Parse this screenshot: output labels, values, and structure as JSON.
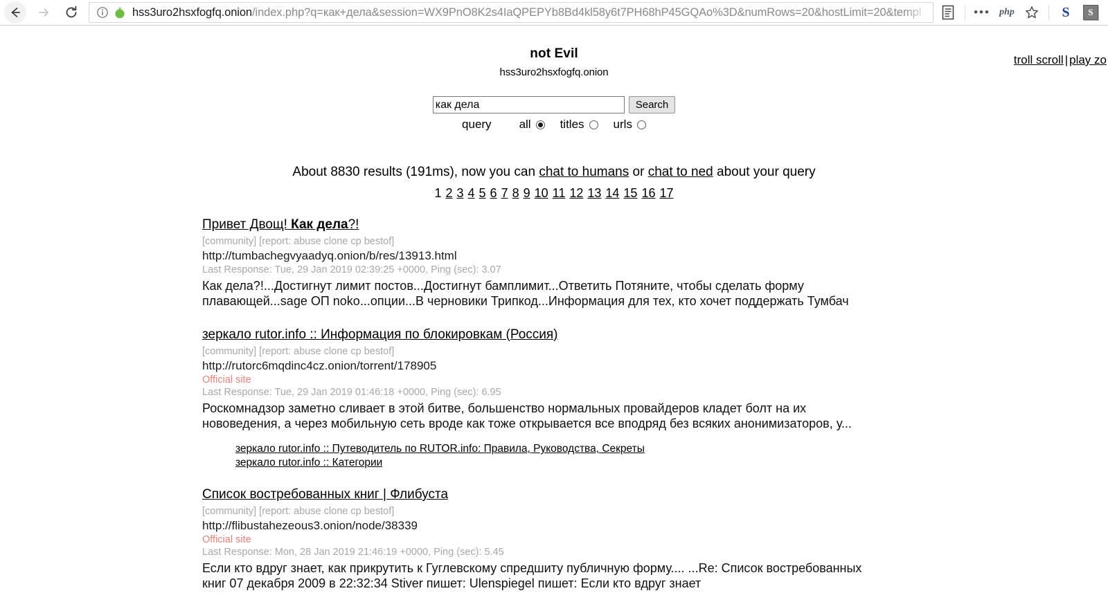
{
  "browser": {
    "back_label": "back-arrow",
    "forward_label": "forward-arrow",
    "reload_label": "reload",
    "url_host": "hss3uro2hsxfogfq.onion",
    "url_rest": "/index.php?q=как+дела&session=WX9PnO8K2s4IaQPEPYb8Bd4kl58y6t7PH68hP45GQAo%3D&numRows=20&hostLimit=20&templ",
    "toolbar_icons": [
      {
        "name": "reader-mode-icon",
        "glyph": "reader"
      },
      {
        "name": "more-options-icon",
        "glyph": "•••"
      },
      {
        "name": "php-extension-icon",
        "glyph": "php"
      },
      {
        "name": "bookmark-star-icon",
        "glyph": "star"
      },
      {
        "name": "s-extension-blue-icon",
        "glyph": "S"
      },
      {
        "name": "s-extension-gray-icon",
        "glyph": "S"
      }
    ]
  },
  "topright": {
    "troll_scroll": "troll scroll",
    "separator": "|",
    "play_zone": "play zo"
  },
  "site": {
    "title": "not Evil",
    "subtitle": "hss3uro2hsxfogfq.onion"
  },
  "search": {
    "query_value": "как дела",
    "placeholder": "",
    "button_label": "Search",
    "query_label": "query",
    "options": [
      {
        "label": "all",
        "checked": true
      },
      {
        "label": "titles",
        "checked": false
      },
      {
        "label": "urls",
        "checked": false
      }
    ]
  },
  "summary": {
    "prefix": "About 8830 results (191ms), now you can ",
    "chat_humans": "chat to humans",
    "middle": " or ",
    "chat_ned": "chat to ned",
    "suffix": " about your query",
    "result_count": "8830",
    "time_ms": "191ms"
  },
  "pagination": {
    "current": "1",
    "pages": [
      "2",
      "3",
      "4",
      "5",
      "6",
      "7",
      "8",
      "9",
      "10",
      "11",
      "12",
      "13",
      "14",
      "15",
      "16",
      "17"
    ]
  },
  "results": [
    {
      "title_plain_before": "Привет Двощ! ",
      "title_bold": "Как дела",
      "title_plain_after": "?!",
      "tags": "[community] [report: abuse clone cp bestof]",
      "url": "http://tumbachegvyaadyq.onion/b/res/13913.html",
      "official": "",
      "meta": "Last Response: Tue, 29 Jan 2019 02:39:25 +0000, Ping (sec): 3.07",
      "snippet": "Как дела?!...Достигнут лимит постов...Достигнут бамплимит...Ответить Потяните, чтобы сделать форму плавающей...sage ОП noko...опции...В черновики Трипкод...Информация для тех, кто хочет поддержать Тумбач",
      "sublinks": []
    },
    {
      "title_plain_before": "зеркало rutor.info :: Информация по блокировкам (Россия)",
      "title_bold": "",
      "title_plain_after": "",
      "tags": "[community] [report: abuse clone cp bestof]",
      "url": "http://rutorc6mqdinc4cz.onion/torrent/178905",
      "official": "Official site",
      "meta": "Last Response: Tue, 29 Jan 2019 01:46:18 +0000, Ping (sec): 6.95",
      "snippet": "Роскомнадзор заметно сливает в этой битве, большенство нормальных провайдеров кладет болт на их нововедения, а через мобильную сеть вроде как тоже открывается все вподряд без всяких анонимизаторов, у...",
      "sublinks": [
        "зеркало rutor.info :: Путеводитель по RUTOR.info: Правила, Руководства, Секреты",
        "зеркало rutor.info :: Категории"
      ]
    },
    {
      "title_plain_before": "Список востребованных книг | Флибуста",
      "title_bold": "",
      "title_plain_after": "",
      "tags": "[community] [report: abuse clone cp bestof]",
      "url": "http://flibustahezeous3.onion/node/38339",
      "official": "Official site",
      "meta": "Last Response: Mon, 28 Jan 2019 21:46:19 +0000, Ping (sec): 5.45",
      "snippet": "Если кто вдруг знает, как прикрутить к Гуглевскому спредшиту публичную форму.... ...Re: Список востребованных книг  07 декабря 2009  в 22:32:34 Stiver пишет:   Ulenspiegel пишет:   Если кто вдруг знает",
      "sublinks": []
    }
  ],
  "colors": {
    "official_site": "#ea8079",
    "meta_gray": "#a8a8a8",
    "onion_green": "#6fbd43",
    "link_blue_s": "#1f3fa0"
  }
}
